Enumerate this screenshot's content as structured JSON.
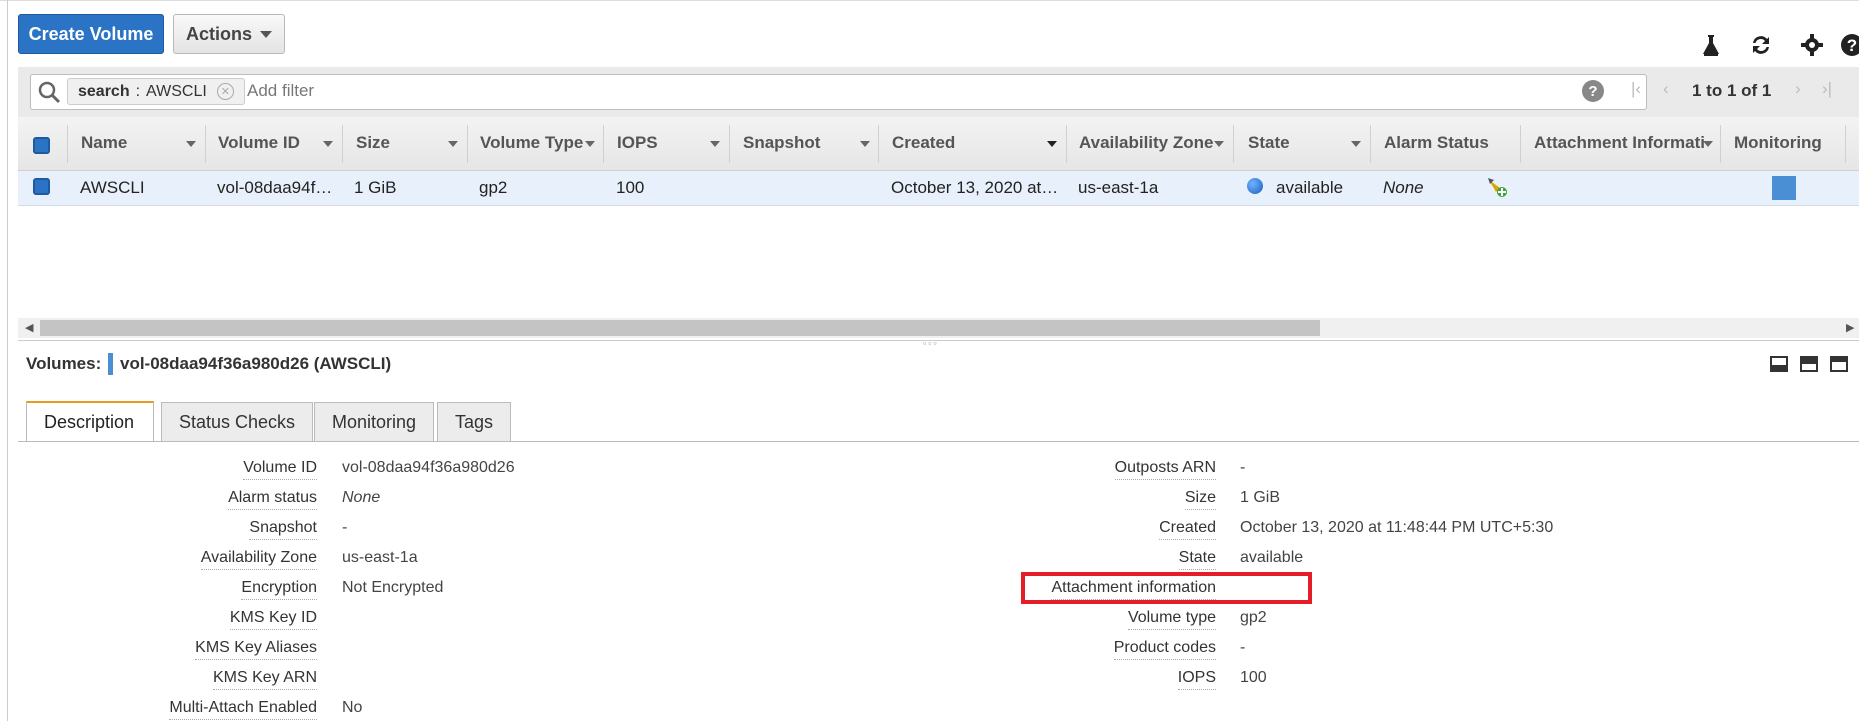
{
  "toolbar": {
    "create_label": "Create Volume",
    "actions_label": "Actions",
    "icons": [
      "flask-icon",
      "refresh-icon",
      "gear-icon",
      "help-icon"
    ]
  },
  "search": {
    "chip_key": "search",
    "chip_value": "AWSCLI",
    "placeholder": "Add filter",
    "help": "?"
  },
  "pagination": {
    "text": "1 to 1 of 1"
  },
  "table": {
    "columns": [
      "Name",
      "Volume ID",
      "Size",
      "Volume Type",
      "IOPS",
      "Snapshot",
      "Created",
      "Availability Zone",
      "State",
      "Alarm Status",
      "Attachment Informatio",
      "Monitoring"
    ],
    "row": {
      "name": "AWSCLI",
      "volume_id": "vol-08daa94f…",
      "size": "1 GiB",
      "volume_type": "gp2",
      "iops": "100",
      "snapshot": "",
      "created": "October 13, 2020 at…",
      "availability_zone": "us-east-1a",
      "state": "available",
      "alarm_status": "None"
    }
  },
  "detail": {
    "prefix": "Volumes:",
    "title": "vol-08daa94f36a980d26 (AWSCLI)",
    "tabs": [
      "Description",
      "Status Checks",
      "Monitoring",
      "Tags"
    ],
    "left": [
      {
        "label": "Volume ID",
        "value": "vol-08daa94f36a980d26"
      },
      {
        "label": "Alarm status",
        "value": "None"
      },
      {
        "label": "Snapshot",
        "value": "-"
      },
      {
        "label": "Availability Zone",
        "value": "us-east-1a"
      },
      {
        "label": "Encryption",
        "value": "Not Encrypted"
      },
      {
        "label": "KMS Key ID",
        "value": ""
      },
      {
        "label": "KMS Key Aliases",
        "value": ""
      },
      {
        "label": "KMS Key ARN",
        "value": ""
      },
      {
        "label": "Multi-Attach Enabled",
        "value": "No"
      }
    ],
    "right": [
      {
        "label": "Outposts ARN",
        "value": "-"
      },
      {
        "label": "Size",
        "value": "1 GiB"
      },
      {
        "label": "Created",
        "value": "October 13, 2020 at 11:48:44 PM UTC+5:30"
      },
      {
        "label": "State",
        "value": "available"
      },
      {
        "label": "Attachment information",
        "value": ""
      },
      {
        "label": "Volume type",
        "value": "gp2"
      },
      {
        "label": "Product codes",
        "value": "-"
      },
      {
        "label": "IOPS",
        "value": "100"
      }
    ]
  },
  "colors": {
    "primary_button": "#2a73c5",
    "selected_row": "#e8f1fb",
    "highlight_box": "#e41e26",
    "active_tab": "#e89b21"
  }
}
